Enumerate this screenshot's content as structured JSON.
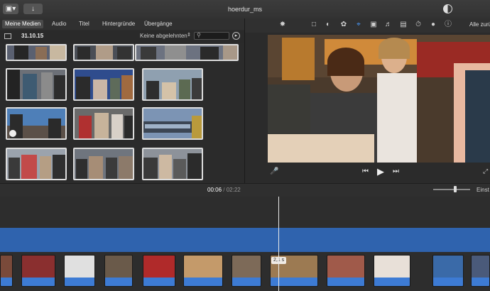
{
  "window": {
    "title": "hoerdur_ms"
  },
  "toolbar": {
    "import_icon": "down-arrow-icon",
    "library_icon": "library-toggle-icon",
    "enhance_icon": "half-circle-icon"
  },
  "tabs": [
    {
      "label": "Meine Medien",
      "active": true
    },
    {
      "label": "Audio",
      "active": false
    },
    {
      "label": "Titel",
      "active": false
    },
    {
      "label": "Hintergründe",
      "active": false
    },
    {
      "label": "Übergänge",
      "active": false
    }
  ],
  "browser": {
    "date_label": "31.10.15",
    "filter_label": "Keine abgelehnten",
    "search_placeholder": ""
  },
  "viewer_tools": {
    "reset_all_label": "Alle zurü"
  },
  "playback": {
    "current_time": "00:06",
    "separator": "/",
    "total_time": "02:22"
  },
  "timeline": {
    "settings_label": "Einst",
    "clip_duration_badge": "2,1 s"
  },
  "colors": {
    "audio_band": "#2f63ae",
    "clip_bar": "#3d7bd4",
    "accent": "#4a9bff"
  }
}
